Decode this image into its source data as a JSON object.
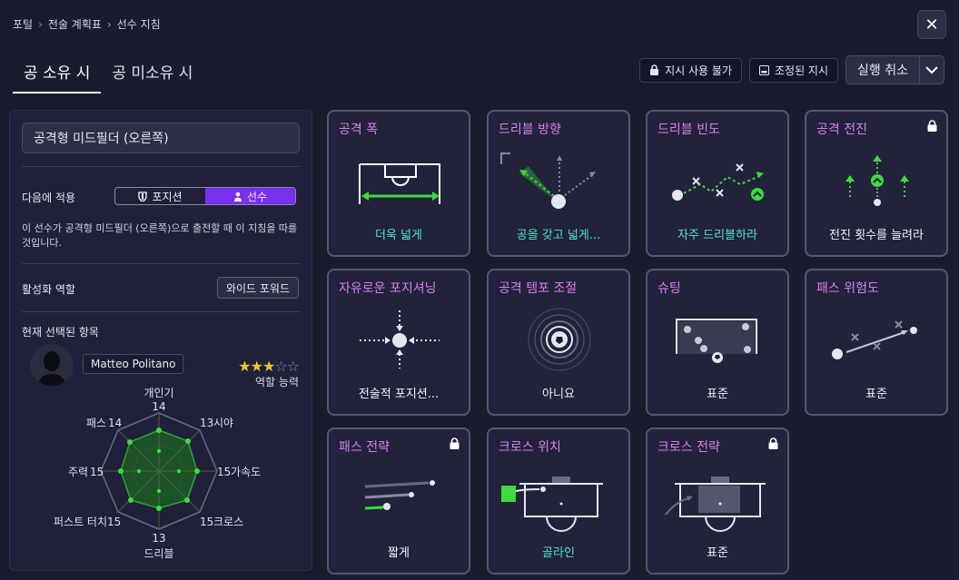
{
  "breadcrumb": {
    "items": [
      "포털",
      "전술 계획표",
      "선수 지침"
    ]
  },
  "close_label": "✕",
  "tabs": [
    {
      "label": "공 소유 시",
      "active": true
    },
    {
      "label": "공 미소유 시",
      "active": false
    }
  ],
  "actions": {
    "lock_label": "지시 사용 불가",
    "adjusted_label": "조정된 지시",
    "undo_label": "실행 취소",
    "undo_chevron": "⌄"
  },
  "left": {
    "role": "공격형 미드필더 (오른쪽)",
    "apply_to_label": "다음에 적용",
    "apply_options": [
      {
        "label": "포지션",
        "icon": "shield-icon",
        "active": false
      },
      {
        "label": "선수",
        "icon": "person-icon",
        "active": true
      }
    ],
    "description": "이 선수가 공격형 미드필더 (오른쪽)으로 출전할 때 이 지침을 따를 것입니다.",
    "active_role_label": "활성화 역할",
    "active_role_value": "와이드 포워드",
    "current_label": "현재 선택된 항목",
    "player_name": "Matteo Politano",
    "role_ability_label": "역할 능력",
    "stars_filled": 3,
    "stars_total": 5,
    "radar": {
      "attributes": [
        {
          "label": "개인기",
          "value": 14
        },
        {
          "label": "시야",
          "value": 13
        },
        {
          "label": "가속도",
          "value": 15
        },
        {
          "label": "크로스",
          "value": 15
        },
        {
          "label": "드리블",
          "value": 13
        },
        {
          "label": "퍼스트 터치",
          "value": 15
        },
        {
          "label": "주력",
          "value": 15
        },
        {
          "label": "패스",
          "value": 14
        }
      ],
      "max": 20
    }
  },
  "cards": [
    {
      "title": "공격 폭",
      "value": "더욱 넓게",
      "value_color": "teal",
      "locked": false
    },
    {
      "title": "드리블 방향",
      "value": "공을 갖고 넓게...",
      "value_color": "teal",
      "locked": false
    },
    {
      "title": "드리블 빈도",
      "value": "자주 드리블하라",
      "value_color": "teal",
      "locked": false
    },
    {
      "title": "공격 전진",
      "value": "전진 횟수를 늘려라",
      "value_color": "white",
      "locked": true
    },
    {
      "title": "자유로운 포지셔닝",
      "value": "전술적 포지션...",
      "value_color": "white",
      "locked": false
    },
    {
      "title": "공격 템포 조절",
      "value": "아니요",
      "value_color": "white",
      "locked": false
    },
    {
      "title": "슈팅",
      "value": "표준",
      "value_color": "white",
      "locked": false
    },
    {
      "title": "패스 위험도",
      "value": "표준",
      "value_color": "white",
      "locked": false
    },
    {
      "title": "패스 전략",
      "value": "짧게",
      "value_color": "white",
      "locked": true
    },
    {
      "title": "크로스 위치",
      "value": "골라인",
      "value_color": "teal",
      "locked": false
    },
    {
      "title": "크로스 전략",
      "value": "표준",
      "value_color": "white",
      "locked": true
    }
  ],
  "colors": {
    "accent_purple": "#7a2ff0",
    "title_pink": "#d680f4",
    "teal": "#4ee6cf",
    "green": "#3ddc3d"
  }
}
